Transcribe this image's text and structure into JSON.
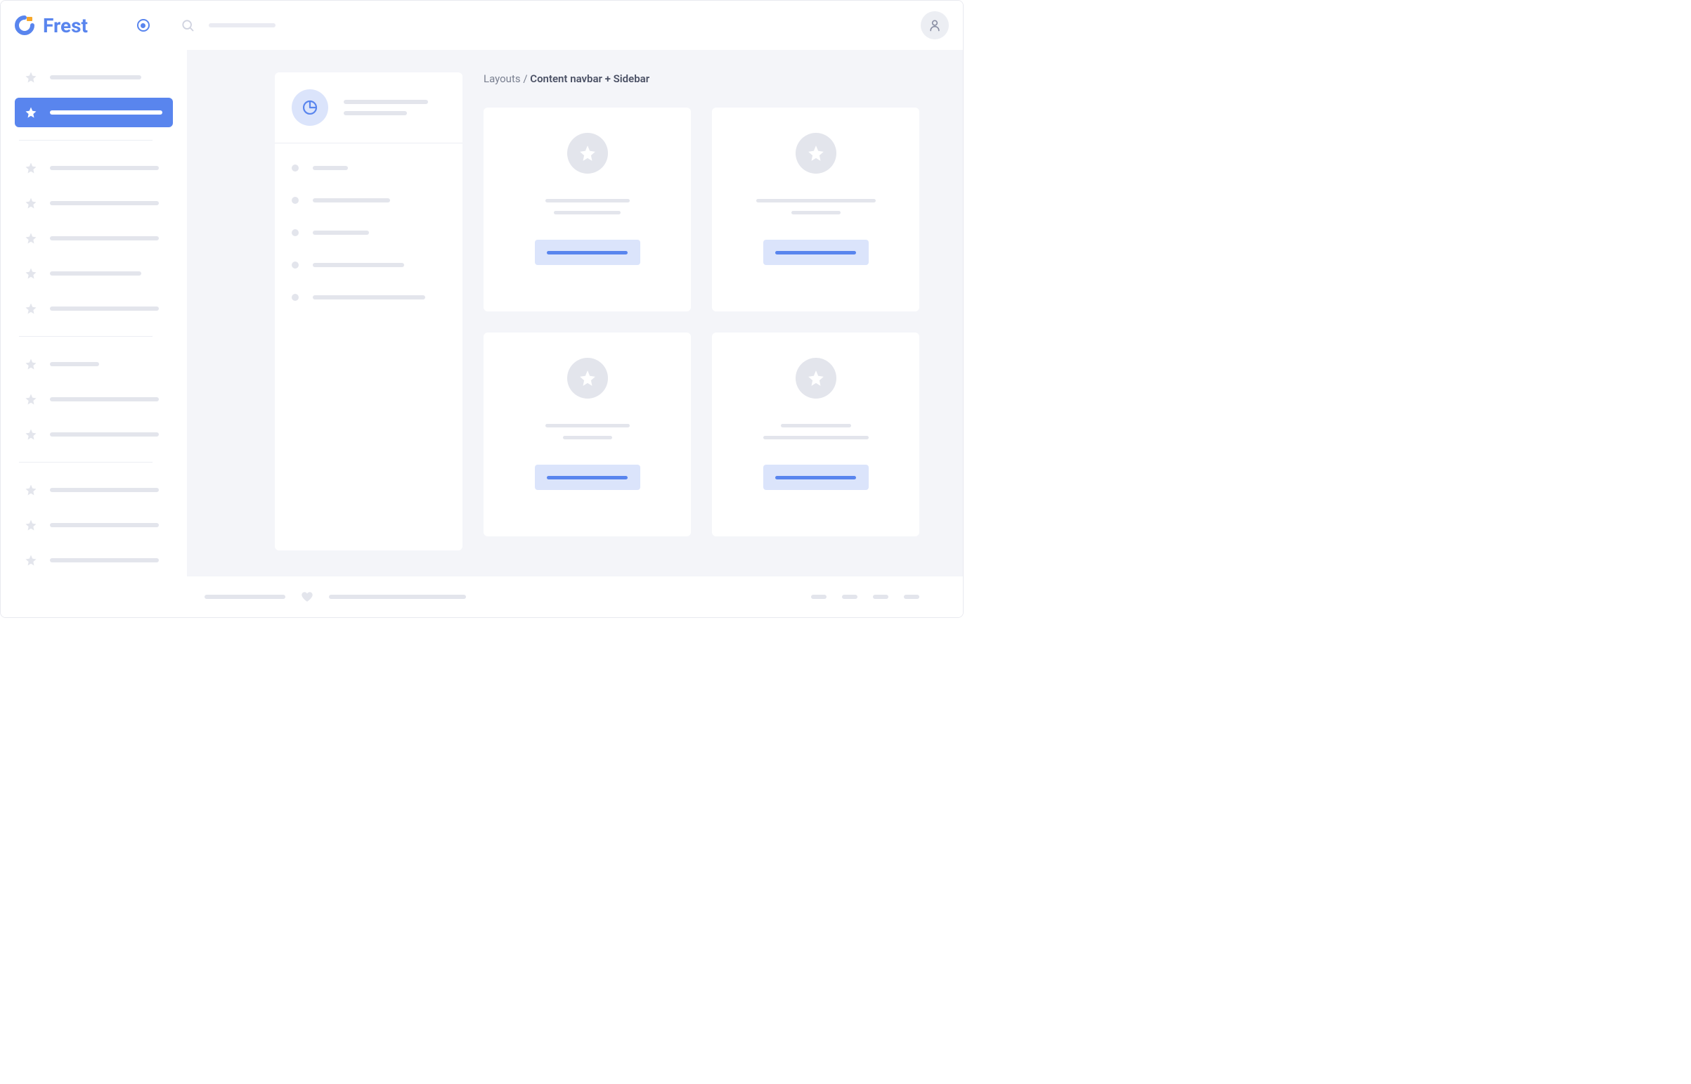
{
  "brand": {
    "name": "Frest"
  },
  "breadcrumb": {
    "parent": "Layouts",
    "separator": "/",
    "current": "Content navbar + Sidebar"
  },
  "icons": {
    "search": "search-icon",
    "user": "user-icon",
    "chart": "pie-chart-icon",
    "star": "star-icon",
    "heart": "heart-icon",
    "toggle": "pin-toggle-icon"
  }
}
